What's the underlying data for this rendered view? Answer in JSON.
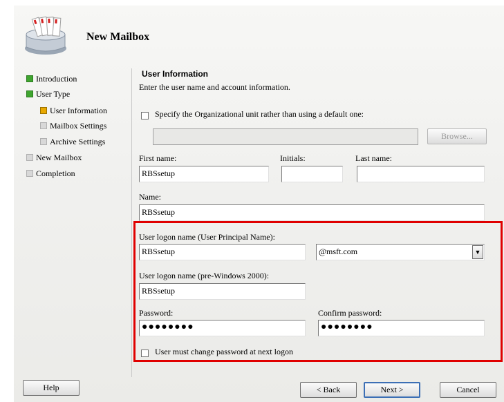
{
  "header": {
    "title": "New Mailbox",
    "icon": "mailbox-wizard-icon"
  },
  "nav": {
    "items": [
      {
        "label": "Introduction",
        "state": "done"
      },
      {
        "label": "User Type",
        "state": "done"
      },
      {
        "label": "User Information",
        "state": "current"
      },
      {
        "label": "Mailbox Settings",
        "state": "pending"
      },
      {
        "label": "Archive Settings",
        "state": "pending"
      },
      {
        "label": "New Mailbox",
        "state": "pending"
      },
      {
        "label": "Completion",
        "state": "pending"
      }
    ]
  },
  "section": {
    "title": "User Information",
    "description": "Enter the user name and account information."
  },
  "ou": {
    "checkbox_label": "Specify the Organizational unit rather than using a default one:",
    "checked": false,
    "value": "",
    "browse_label": "Browse..."
  },
  "name_fields": {
    "first_name_label": "First name:",
    "first_name_value": "RBSsetup",
    "initials_label": "Initials:",
    "initials_value": "",
    "last_name_label": "Last name:",
    "last_name_value": "",
    "name_label": "Name:",
    "name_value": "RBSsetup"
  },
  "logon": {
    "upn_label": "User logon name (User Principal Name):",
    "upn_value": "RBSsetup",
    "domain_value": "@msft.com",
    "pre2000_label": "User logon name (pre-Windows 2000):",
    "pre2000_value": "RBSsetup",
    "password_label": "Password:",
    "password_value": "●●●●●●●●",
    "confirm_label": "Confirm password:",
    "confirm_value": "●●●●●●●●",
    "must_change_label": "User must change password at next logon",
    "must_change_checked": false
  },
  "footer": {
    "help_label": "Help",
    "back_label": "< Back",
    "next_label": "Next >",
    "cancel_label": "Cancel"
  },
  "colors": {
    "highlight": "#e00000",
    "done": "#3fa52f",
    "current": "#e8a800"
  }
}
